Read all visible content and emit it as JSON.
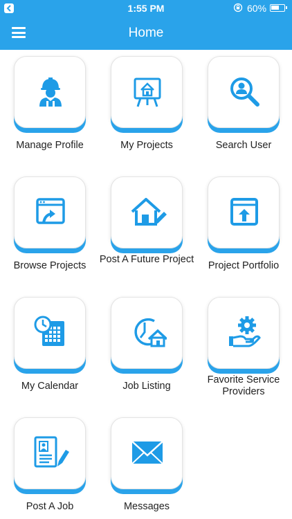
{
  "status_bar": {
    "time": "1:55 PM",
    "battery": "60%"
  },
  "nav": {
    "title": "Home"
  },
  "colors": {
    "accent": "#2aa3ea",
    "icon": "#1e9be6"
  },
  "tiles": [
    {
      "label": "Manage Profile",
      "icon": "worker-icon"
    },
    {
      "label": "My Projects",
      "icon": "presentation-house-icon"
    },
    {
      "label": "Search User",
      "icon": "search-user-icon"
    },
    {
      "label": "Browse Projects",
      "icon": "browser-upload-icon"
    },
    {
      "label": "Post A Future Project",
      "icon": "house-pencil-icon"
    },
    {
      "label": "Project Portfolio",
      "icon": "upload-box-icon"
    },
    {
      "label": "My Calendar",
      "icon": "calendar-clock-icon"
    },
    {
      "label": "Job Listing",
      "icon": "clock-house-icon"
    },
    {
      "label": "Favorite Service Providers",
      "icon": "hand-gear-icon"
    },
    {
      "label": "Post A Job",
      "icon": "resume-pencil-icon"
    },
    {
      "label": "Messages",
      "icon": "envelope-icon"
    }
  ]
}
